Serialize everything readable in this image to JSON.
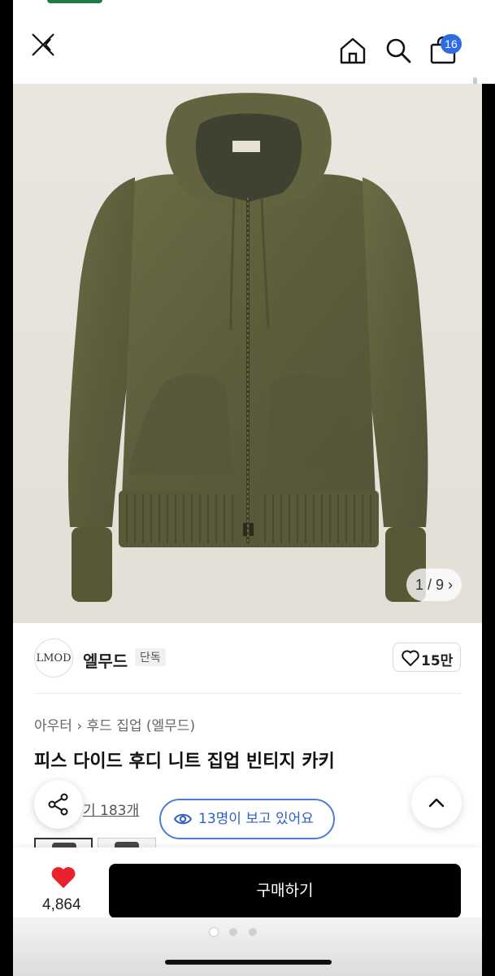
{
  "header": {
    "close_icon": "close-icon",
    "cart_count": "16"
  },
  "hero": {
    "counter": "1 / 9"
  },
  "brand": {
    "logo_text": "LMOD",
    "name": "엘무드",
    "tag": "단독",
    "likes": "15만"
  },
  "product": {
    "breadcrumb": [
      "아우터",
      "후드 집업 (엘무드)"
    ],
    "title": "피스 다이드 후디 니트 집업 빈티지 카키",
    "reviews": "기 183개",
    "viewers": "13명이 보고 있어요"
  },
  "bottom_bar": {
    "like_count": "4,864",
    "buy_label": "구매하기"
  },
  "colors": {
    "accent_blue": "#2f6be4",
    "heart_red": "#e8232d",
    "jacket_khaki": "#5e5f3c"
  }
}
